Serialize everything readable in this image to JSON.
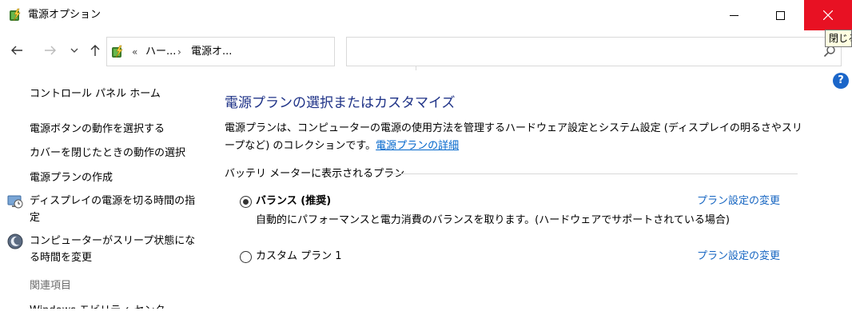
{
  "window": {
    "title": "電源オプション",
    "close_tooltip": "閉じる"
  },
  "nav": {
    "breadcrumb_overflow": "«",
    "breadcrumbs": [
      "ハー...",
      "電源オ..."
    ],
    "separator": "›",
    "search_placeholder": ""
  },
  "sidebar": {
    "home": "コントロール パネル ホーム",
    "links": [
      "電源ボタンの動作を選択する",
      "カバーを閉じたときの動作の選択",
      "電源プランの作成",
      "ディスプレイの電源を切る時間の指定",
      "コンピューターがスリープ状態になる時間を変更"
    ],
    "related_header": "関連項目",
    "cut_item": "Windows モビリティ センター"
  },
  "main": {
    "title": "電源プランの選択またはカスタマイズ",
    "description": "電源プランは、コンピューターの電源の使用方法を管理するハードウェア設定とシステム設定 (ディスプレイの明るさやスリープなど) のコレクションです。",
    "details_link": "電源プランの詳細",
    "section_header": "バッテリ メーターに表示されるプラン",
    "plans": [
      {
        "name": "バランス (推奨)",
        "description": "自動的にパフォーマンスと電力消費のバランスを取ります。(ハードウェアでサポートされている場合)",
        "link": "プラン設定の変更",
        "selected": true
      },
      {
        "name": "カスタム プラン 1",
        "link": "プラン設定の変更",
        "selected": false
      }
    ]
  },
  "help_label": "?",
  "colors": {
    "title_blue": "#1e3287",
    "link_blue": "#1766c2",
    "close_red": "#e81123"
  }
}
